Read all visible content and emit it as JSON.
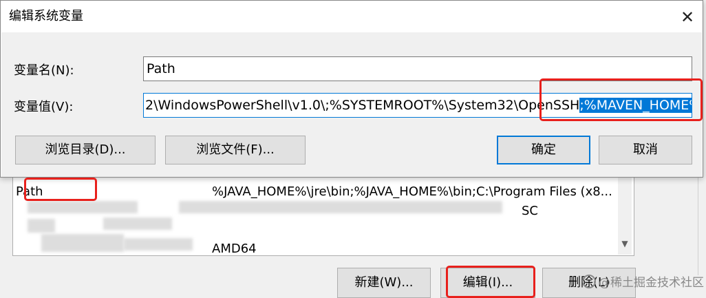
{
  "dialog": {
    "title": "编辑系统变量",
    "close_glyph": "✕",
    "name_label": "变量名(N):",
    "name_value": "Path",
    "value_label": "变量值(V):",
    "value_prefix": "2\\WindowsPowerShell\\v1.0\\;%SYSTEMROOT%\\System32\\OpenSSH",
    "value_selected": ";%MAVEN_HOME%\\bin;",
    "browse_dir_label": "浏览目录(D)...",
    "browse_file_label": "浏览文件(F)...",
    "ok_label": "确定",
    "cancel_label": "取消"
  },
  "background": {
    "rows": [
      {
        "name": "Path",
        "value": "%JAVA_HOME%\\jre\\bin;%JAVA_HOME%\\bin;C:\\Program Files (x8..."
      },
      {
        "name": "",
        "value": "SC"
      },
      {
        "name": "",
        "value": ""
      },
      {
        "name": "",
        "value": "AMD64"
      }
    ],
    "new_label": "新建(W)...",
    "edit_label": "编辑(I)...",
    "delete_label": "删除(L)"
  },
  "watermark": "@稀土掘金技术社区",
  "colors": {
    "highlight": "#e8201c",
    "selection": "#0078d7"
  }
}
